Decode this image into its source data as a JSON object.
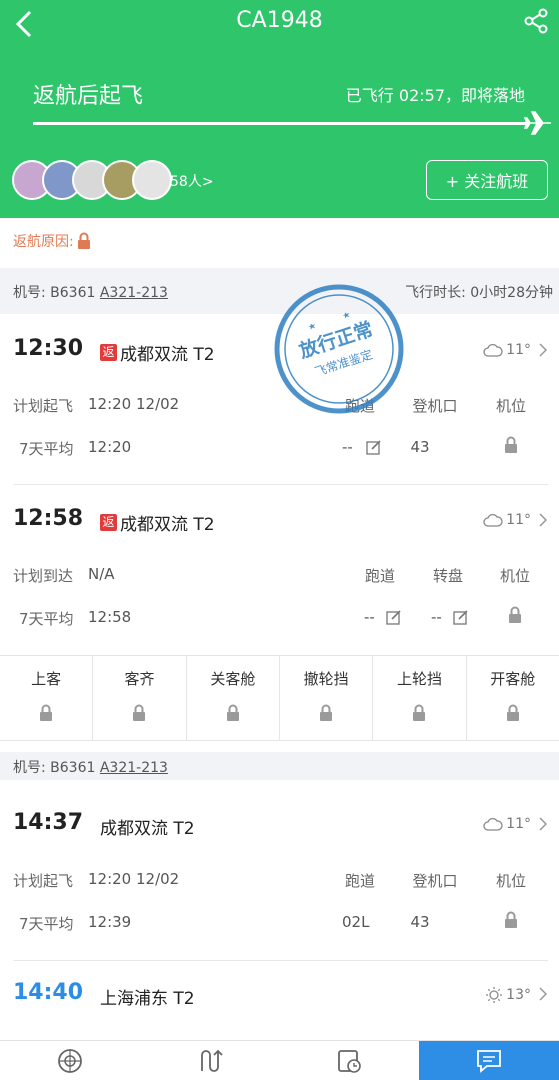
{
  "header": {
    "title": "CA1948",
    "state": "返航后起飞",
    "elapsed": "已飞行 02:57，即将落地",
    "followers": "58人>",
    "follow_button": "+ 关注航班"
  },
  "reason": {
    "label": "返航原因:"
  },
  "section1": {
    "machine_label": "机号: B6361",
    "aircraft_model": "A321-213",
    "duration": "飞行时长: 0小时28分钟",
    "departure": {
      "time": "12:30",
      "tag": "返",
      "airport": "成都双流 T2",
      "weather": "11°",
      "plan_label": "计划起飞",
      "plan_value": "12:20 12/02",
      "avg_label": "7天平均",
      "avg_value": "12:20",
      "col1_header": "跑道",
      "col2_header": "登机口",
      "col3_header": "机位",
      "runway": "--",
      "gate": "43"
    },
    "arrival": {
      "time": "12:58",
      "tag": "返",
      "airport": "成都双流 T2",
      "weather": "11°",
      "plan_label": "计划到达",
      "plan_value": "N/A",
      "avg_label": "7天平均",
      "avg_value": "12:58",
      "col1_header": "跑道",
      "col2_header": "转盘",
      "col3_header": "机位",
      "runway": "--",
      "carousel": "--"
    },
    "status_cells": [
      "上客",
      "客齐",
      "关客舱",
      "撤轮挡",
      "上轮挡",
      "开客舱"
    ]
  },
  "stamp": {
    "line1": "放行正常",
    "line2": "飞常准鉴定"
  },
  "section2": {
    "machine_label": "机号: B6361",
    "aircraft_model": "A321-213",
    "departure": {
      "time": "14:37",
      "airport": "成都双流 T2",
      "weather": "11°",
      "plan_label": "计划起飞",
      "plan_value": "12:20 12/02",
      "avg_label": "7天平均",
      "avg_value": "12:39",
      "col1_header": "跑道",
      "col2_header": "登机口",
      "col3_header": "机位",
      "runway": "02L",
      "gate": "43"
    },
    "arrival": {
      "time": "14:40",
      "airport": "上海浦东 T2",
      "weather": "13°"
    }
  },
  "icons": [
    "back-icon",
    "share-icon",
    "plane-icon",
    "lock-icon",
    "edit-icon",
    "cloud-icon",
    "sun-icon",
    "chevron-right-icon",
    "radar-icon",
    "route-icon",
    "schedule-icon",
    "chat-icon"
  ],
  "colors": {
    "header_green": "#2ec56b",
    "reason_orange": "#e07a52",
    "arrival_blue": "#2a8ee6",
    "return_red": "#e23b3b",
    "active_tab": "#2e8ee6"
  }
}
